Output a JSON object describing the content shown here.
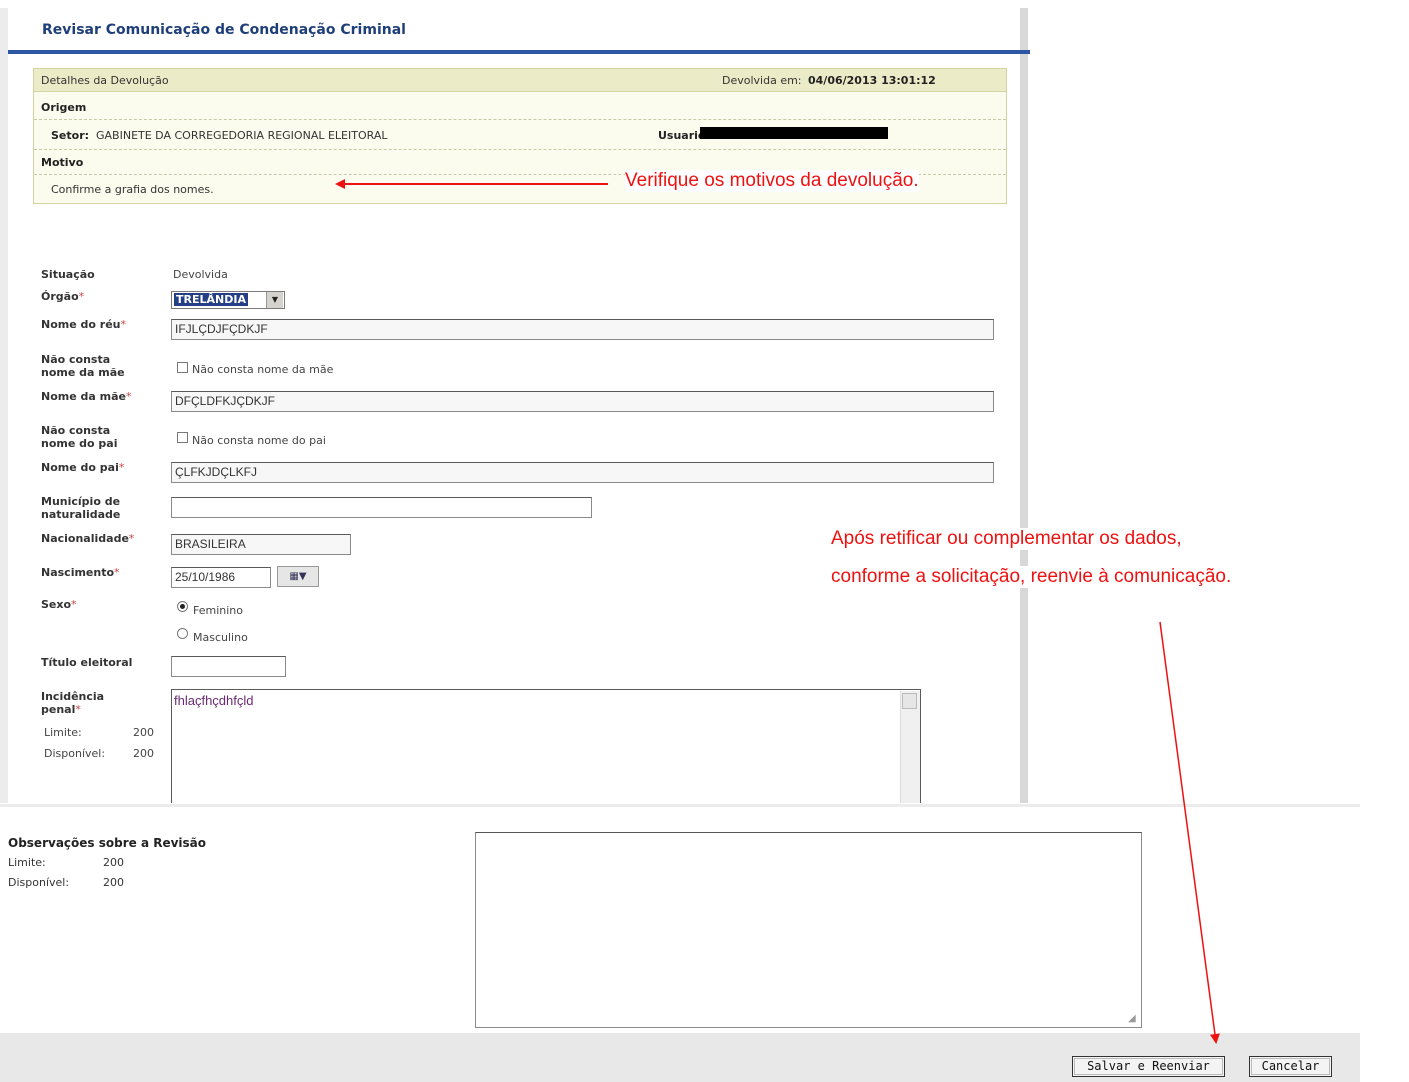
{
  "window": {
    "title": "Revisar Comunicação de Condenação Criminal"
  },
  "details": {
    "header": "Detalhes da Devolução",
    "returned_label": "Devolvida em:",
    "returned_at": "04/06/2013 13:01:12",
    "origin_label": "Origem",
    "sector_label": "Setor:",
    "sector_value": "GABINETE DA CORREGEDORIA REGIONAL ELEITORAL",
    "user_label": "Usuario:",
    "reason_label": "Motivo",
    "reason_value": "Confirme a grafia dos nomes."
  },
  "form": {
    "situacao_label": "Situação",
    "situacao_value": "Devolvida",
    "orgao_label": "Órgão",
    "orgao_value": "TRELÂNDIA",
    "nome_reu_label": "Nome do réu",
    "nome_reu_value": "IFJLÇDJFÇDKJF",
    "nao_consta_mae_label_1": "Não consta",
    "nao_consta_mae_label_2": "nome da mãe",
    "nao_consta_mae_check": "Não consta nome da mãe",
    "nome_mae_label": "Nome da mãe",
    "nome_mae_value": "DFÇLDFKJÇDKJF",
    "nao_consta_pai_label_1": "Não consta",
    "nao_consta_pai_label_2": "nome do pai",
    "nao_consta_pai_check": "Não consta nome do pai",
    "nome_pai_label": "Nome do pai",
    "nome_pai_value": "ÇLFKJDÇLKFJ",
    "municipio_label_1": "Município de",
    "municipio_label_2": "naturalidade",
    "municipio_value": "",
    "nacionalidade_label": "Nacionalidade",
    "nacionalidade_value": "BRASILEIRA",
    "nascimento_label": "Nascimento",
    "nascimento_value": "25/10/1986",
    "sexo_label": "Sexo",
    "sexo_feminino": "Feminino",
    "sexo_masculino": "Masculino",
    "titulo_label": "Título eleitoral",
    "titulo_value": "",
    "incidencia_label_1": "Incidência",
    "incidencia_label_2": "penal",
    "incidencia_limite_label": "Limite:",
    "incidencia_limite_value": "200",
    "incidencia_disp_label": "Disponível:",
    "incidencia_disp_value": "200",
    "incidencia_value": "fhlaçfhçdhfçld",
    "required_mark": "*"
  },
  "observacoes": {
    "label": "Observações sobre a Revisão",
    "limite_label": "Limite:",
    "limite_value": "200",
    "disp_label": "Disponível:",
    "disp_value": "200",
    "value": ""
  },
  "buttons": {
    "save": "Salvar e Reenviar",
    "cancel": "Cancelar"
  },
  "annotations": {
    "note1": "Verifique os motivos da devolução.",
    "note2_line1": "Após retificar ou complementar os dados,",
    "note2_line2": "conforme a solicitação, reenvie à comunicação."
  },
  "colors": {
    "title": "#1f3f7a",
    "accent_bar": "#2d56a3",
    "annotation": "#ee1111",
    "details_bg": "#fbfbee"
  }
}
